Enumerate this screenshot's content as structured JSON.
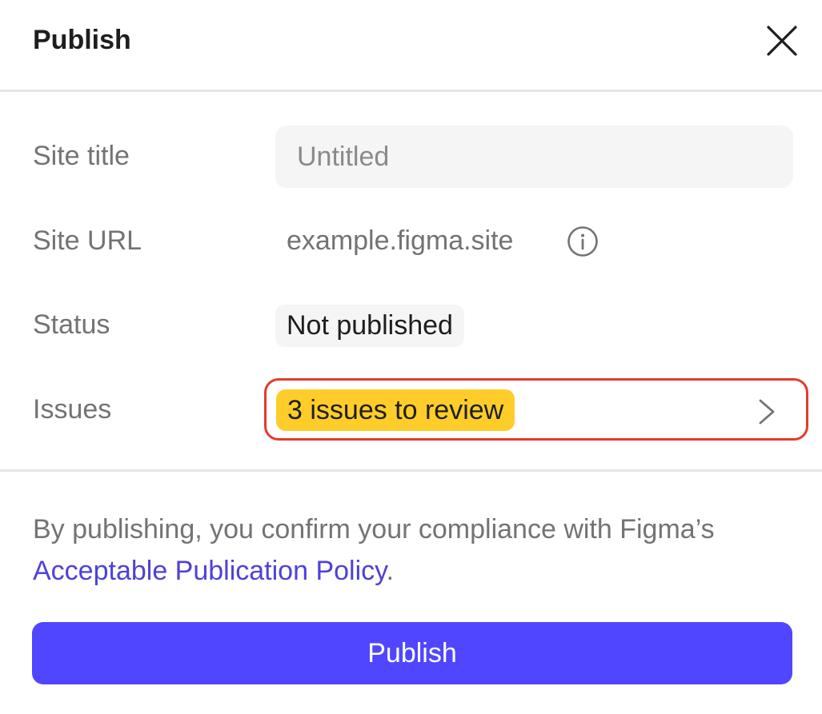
{
  "dialog": {
    "title": "Publish",
    "close_icon": "close-icon"
  },
  "fields": {
    "site_title": {
      "label": "Site title",
      "value": "",
      "placeholder": "Untitled"
    },
    "site_url": {
      "label": "Site URL",
      "value": "example.figma.site",
      "info_icon": "info-icon"
    },
    "status": {
      "label": "Status",
      "value": "Not published"
    },
    "issues": {
      "label": "Issues",
      "value": "3 issues to review",
      "chevron_icon": "chevron-right-icon"
    }
  },
  "footer": {
    "compliance_prefix": "By publishing, you confirm your compliance with Figma’s ",
    "policy_link": "Acceptable Publication Policy",
    "compliance_suffix": ".",
    "publish_label": "Publish"
  },
  "colors": {
    "primary": "#5046ff",
    "link": "#4d42d9",
    "issues_badge": "#ffcd29",
    "highlight_border": "#e53a2d",
    "muted_text": "#737373",
    "field_background": "#f5f5f5"
  }
}
